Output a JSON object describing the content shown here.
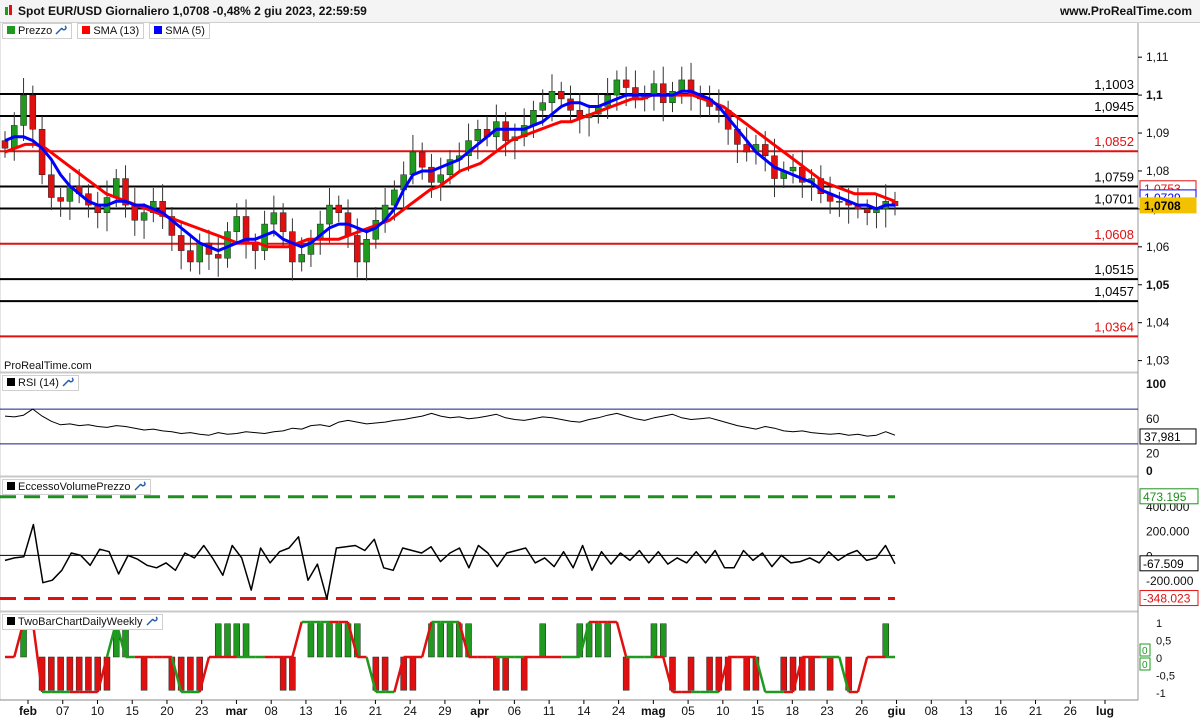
{
  "header": {
    "title": "Spot EUR/USD Giornaliero 1,0708 -0,48% 2 giu 2023, 22:59:59",
    "site": "www.ProRealTime.com"
  },
  "legend": {
    "price": "Prezzo",
    "sma13": "SMA (13)",
    "sma5": "SMA (5)",
    "rsi": "RSI (14)",
    "evp": "EccessoVolumePrezzo",
    "tbc": "TwoBarChartDailyWeekly"
  },
  "watermark": "ProRealTime.com",
  "colors": {
    "up": "#1f9a1f",
    "down": "#e01010",
    "sma13": "#ff0000",
    "sma5": "#0000ff",
    "black": "#000000",
    "green_dash": "#1f8f1f",
    "red_dash": "#e01010"
  },
  "x_labels": [
    "feb",
    "07",
    "10",
    "15",
    "20",
    "23",
    "mar",
    "08",
    "13",
    "16",
    "21",
    "24",
    "29",
    "apr",
    "06",
    "11",
    "14",
    "24",
    "mag",
    "05",
    "10",
    "15",
    "18",
    "23",
    "26",
    "giu",
    "08",
    "13",
    "16",
    "21",
    "26",
    "lug"
  ],
  "chart_data": [
    {
      "type": "candlestick",
      "name": "Prezzo",
      "y_ticks": [
        "1,11",
        "1,1",
        "1,09",
        "1,08",
        "1,07",
        "1,06",
        "1,05",
        "1,04",
        "1,03"
      ],
      "ylim": [
        1.027,
        1.114
      ],
      "levels": [
        {
          "value": 1.1003,
          "label": "1,1003",
          "color": "#000000"
        },
        {
          "value": 1.0945,
          "label": "1,0945",
          "color": "#000000"
        },
        {
          "value": 1.0852,
          "label": "1,0852",
          "color": "#e01010"
        },
        {
          "value": 1.0759,
          "label": "1,0759",
          "color": "#000000"
        },
        {
          "value": 1.0701,
          "label": "1,0701",
          "color": "#000000"
        },
        {
          "value": 1.0608,
          "label": "1,0608",
          "color": "#e01010"
        },
        {
          "value": 1.0515,
          "label": "1,0515",
          "color": "#000000"
        },
        {
          "value": 1.0457,
          "label": "1,0457",
          "color": "#000000"
        },
        {
          "value": 1.0364,
          "label": "1,0364",
          "color": "#e01010"
        }
      ],
      "price_tags": [
        {
          "value": 1.0753,
          "label": "1,0753"
        },
        {
          "value": 1.0729,
          "label": "1,0729"
        },
        {
          "value": 1.0708,
          "label": "1,0708"
        }
      ],
      "closes": [
        1.086,
        1.092,
        1.1,
        1.091,
        1.079,
        1.073,
        1.072,
        1.076,
        1.074,
        1.071,
        1.069,
        1.073,
        1.078,
        1.071,
        1.067,
        1.069,
        1.072,
        1.068,
        1.063,
        1.059,
        1.056,
        1.061,
        1.058,
        1.057,
        1.064,
        1.068,
        1.061,
        1.059,
        1.066,
        1.069,
        1.064,
        1.056,
        1.058,
        1.062,
        1.066,
        1.071,
        1.069,
        1.063,
        1.056,
        1.062,
        1.067,
        1.071,
        1.075,
        1.079,
        1.085,
        1.081,
        1.077,
        1.079,
        1.083,
        1.084,
        1.088,
        1.091,
        1.089,
        1.093,
        1.088,
        1.089,
        1.092,
        1.096,
        1.098,
        1.101,
        1.099,
        1.096,
        1.094,
        1.095,
        1.097,
        1.1,
        1.104,
        1.102,
        1.099,
        1.1,
        1.103,
        1.098,
        1.101,
        1.104,
        1.1,
        1.099,
        1.097,
        1.096,
        1.091,
        1.087,
        1.085,
        1.087,
        1.084,
        1.078,
        1.08,
        1.081,
        1.077,
        1.078,
        1.074,
        1.072,
        1.072,
        1.071,
        1.07,
        1.069,
        1.07,
        1.072,
        1.0708
      ],
      "sma5": [
        1.088,
        1.089,
        1.089,
        1.088,
        1.086,
        1.083,
        1.079,
        1.076,
        1.074,
        1.072,
        1.071,
        1.071,
        1.072,
        1.072,
        1.071,
        1.071,
        1.07,
        1.069,
        1.067,
        1.065,
        1.063,
        1.061,
        1.06,
        1.059,
        1.06,
        1.061,
        1.062,
        1.062,
        1.063,
        1.064,
        1.062,
        1.061,
        1.06,
        1.061,
        1.063,
        1.065,
        1.066,
        1.066,
        1.065,
        1.064,
        1.065,
        1.067,
        1.07,
        1.075,
        1.079,
        1.08,
        1.08,
        1.081,
        1.082,
        1.083,
        1.085,
        1.087,
        1.089,
        1.091,
        1.091,
        1.091,
        1.091,
        1.092,
        1.093,
        1.095,
        1.097,
        1.098,
        1.098,
        1.097,
        1.097,
        1.098,
        1.099,
        1.1,
        1.1,
        1.1,
        1.1,
        1.1,
        1.1,
        1.101,
        1.101,
        1.1,
        1.099,
        1.097,
        1.094,
        1.091,
        1.088,
        1.085,
        1.083,
        1.081,
        1.08,
        1.079,
        1.078,
        1.077,
        1.075,
        1.074,
        1.073,
        1.072,
        1.071,
        1.071,
        1.07,
        1.071,
        1.071
      ],
      "sma13": [
        1.085,
        1.086,
        1.087,
        1.087,
        1.086,
        1.084,
        1.082,
        1.08,
        1.078,
        1.076,
        1.074,
        1.073,
        1.072,
        1.071,
        1.07,
        1.069,
        1.068,
        1.067,
        1.066,
        1.065,
        1.064,
        1.063,
        1.062,
        1.061,
        1.061,
        1.061,
        1.06,
        1.06,
        1.06,
        1.061,
        1.062,
        1.062,
        1.062,
        1.062,
        1.063,
        1.064,
        1.065,
        1.066,
        1.067,
        1.069,
        1.071,
        1.073,
        1.075,
        1.076,
        1.078,
        1.08,
        1.081,
        1.082,
        1.084,
        1.086,
        1.088,
        1.089,
        1.09,
        1.091,
        1.092,
        1.093,
        1.093,
        1.094,
        1.095,
        1.096,
        1.097,
        1.098,
        1.099,
        1.099,
        1.1,
        1.1,
        1.1,
        1.1,
        1.1,
        1.099,
        1.098,
        1.097,
        1.095,
        1.093,
        1.091,
        1.089,
        1.087,
        1.085,
        1.083,
        1.081,
        1.079,
        1.077,
        1.076,
        1.075,
        1.074,
        1.074,
        1.074,
        1.073,
        1.072
      ]
    },
    {
      "type": "line",
      "name": "RSI (14)",
      "y_ticks": [
        "100",
        "60",
        "20",
        "0"
      ],
      "levels": [
        70,
        30
      ],
      "ylim": [
        0,
        100
      ],
      "last_label": "37,981",
      "values": [
        62,
        61,
        63,
        70,
        62,
        56,
        52,
        53,
        51,
        52,
        50,
        49,
        51,
        50,
        48,
        46,
        47,
        45,
        44,
        42,
        43,
        41,
        40,
        43,
        41,
        42,
        44,
        43,
        42,
        44,
        45,
        48,
        47,
        51,
        52,
        50,
        55,
        57,
        55,
        53,
        54,
        55,
        57,
        58,
        60,
        62,
        65,
        62,
        60,
        61,
        59,
        60,
        62,
        64,
        60,
        58,
        57,
        59,
        61,
        60,
        58,
        56,
        55,
        58,
        60,
        63,
        65,
        62,
        59,
        57,
        60,
        62,
        64,
        60,
        58,
        59,
        60,
        57,
        54,
        51,
        49,
        47,
        50,
        48,
        45,
        44,
        45,
        43,
        42,
        41,
        42,
        40,
        41,
        39,
        40,
        44,
        40
      ]
    },
    {
      "type": "line",
      "name": "EccessoVolumePrezzo",
      "y_ticks": [
        "400.000",
        "200.000",
        "0",
        "-200.000"
      ],
      "levels_labels": [
        "473.195",
        "-67.509",
        "-348.023"
      ],
      "upper": 473195,
      "lower": -348023,
      "last_label": "-67.509",
      "ylim": [
        -400000,
        520000
      ],
      "values": [
        -40000,
        -20000,
        -10000,
        250000,
        -220000,
        -200000,
        -120000,
        20000,
        0,
        -80000,
        50000,
        30000,
        -150000,
        0,
        -30000,
        -80000,
        -100000,
        -60000,
        -120000,
        20000,
        -20000,
        80000,
        -30000,
        -160000,
        80000,
        -20000,
        -280000,
        60000,
        -60000,
        30000,
        60000,
        150000,
        -200000,
        -70000,
        -350000,
        60000,
        70000,
        80000,
        40000,
        130000,
        -100000,
        -120000,
        60000,
        40000,
        20000,
        70000,
        -50000,
        20000,
        60000,
        -100000,
        80000,
        20000,
        -90000,
        20000,
        40000,
        60000,
        -60000,
        -20000,
        -90000,
        30000,
        -100000,
        80000,
        -120000,
        30000,
        -70000,
        20000,
        -40000,
        40000,
        -60000,
        30000,
        -70000,
        -20000,
        -60000,
        30000,
        -60000,
        40000,
        -100000,
        -100000,
        40000,
        -40000,
        20000,
        -90000,
        0,
        -60000,
        -50000,
        -20000,
        -60000,
        30000,
        -40000,
        10000,
        40000,
        -40000,
        -20000,
        80000,
        -67509
      ]
    },
    {
      "type": "bar",
      "name": "TwoBarChartDailyWeekly",
      "y_ticks": [
        "1",
        "0,5",
        "0",
        "-0,5",
        "-1"
      ],
      "side_labels": [
        "0",
        "0"
      ],
      "ylim": [
        -1,
        1
      ],
      "values": [
        0,
        0,
        1,
        0,
        -1,
        -1,
        -1,
        -1,
        -1,
        -1,
        -1,
        -1,
        1,
        1,
        0,
        -1,
        0,
        0,
        -1,
        -1,
        -1,
        -1,
        0,
        1,
        1,
        1,
        1,
        0,
        0,
        0,
        -1,
        -1,
        0,
        1,
        1,
        1,
        1,
        1,
        1,
        0,
        -1,
        -1,
        0,
        -1,
        -1,
        0,
        1,
        1,
        1,
        1,
        1,
        0,
        0,
        -1,
        -1,
        0,
        -1,
        0,
        1,
        0,
        0,
        0,
        1,
        1,
        1,
        1,
        0,
        -1,
        0,
        0,
        1,
        1,
        -1,
        0,
        -1,
        0,
        -1,
        -1,
        -1,
        0,
        -1,
        -1,
        0,
        0,
        -1,
        -1,
        -1,
        -1,
        0,
        -1,
        0,
        -1,
        0,
        0,
        0,
        1,
        0
      ],
      "trend": [
        0,
        0,
        1,
        1,
        -1,
        -1,
        -1,
        -1,
        -1,
        -1,
        -1,
        0,
        1,
        0,
        0,
        0,
        0,
        0,
        0,
        -1,
        -1,
        -1,
        0,
        0,
        0,
        0,
        0,
        0,
        0,
        0,
        0,
        0,
        1,
        1,
        1,
        1,
        1,
        1,
        0,
        0,
        -1,
        -1,
        -1,
        0,
        0,
        0,
        1,
        1,
        1,
        1,
        0,
        0,
        0,
        0,
        0,
        0,
        0,
        0,
        0,
        0,
        0,
        0,
        0,
        1,
        1,
        1,
        1,
        0,
        0,
        0,
        0,
        0,
        -1,
        -1,
        -1,
        -1,
        -1,
        -1,
        0,
        0,
        0,
        0,
        -1,
        -1,
        -1,
        -1,
        0,
        0,
        0,
        0,
        0,
        -1,
        -1,
        0,
        0,
        0,
        0
      ]
    }
  ]
}
